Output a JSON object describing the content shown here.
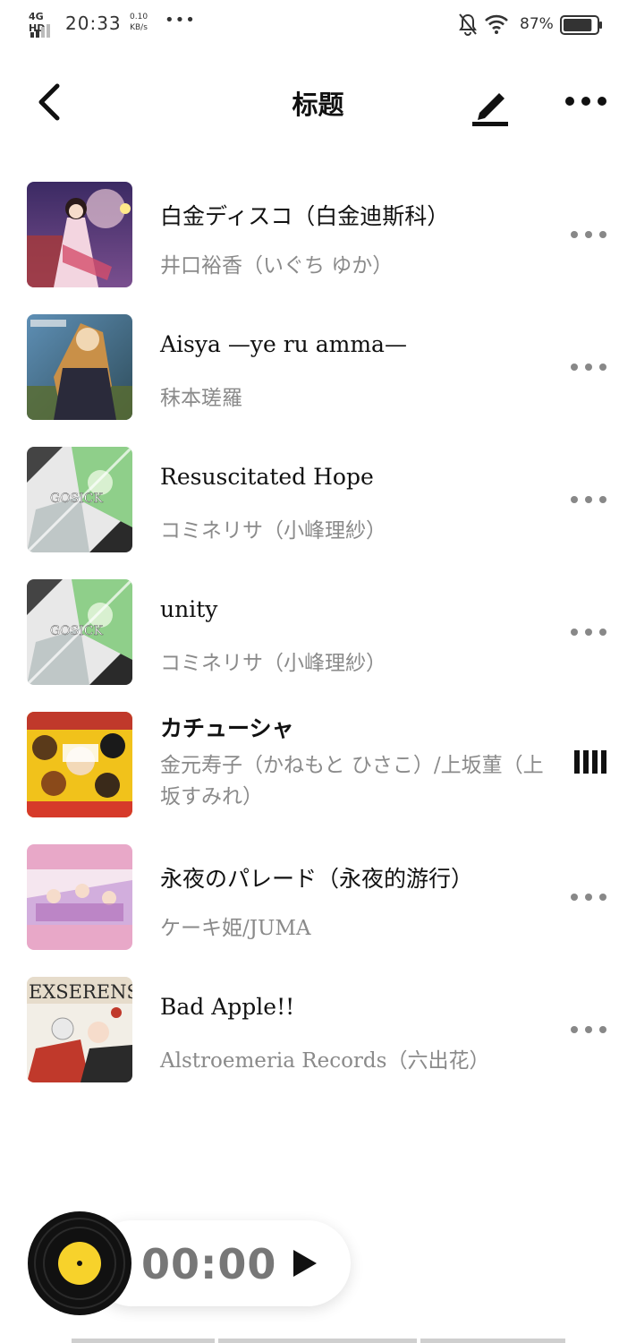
{
  "status_bar": {
    "network": "4G HD",
    "time": "20:33",
    "speed_value": "0.10",
    "speed_unit": "KB/s",
    "more": "•••",
    "battery_percent": "87%",
    "battery_level": 0.87
  },
  "header": {
    "title": "标题"
  },
  "songs": [
    {
      "title": "白金ディスコ（白金迪斯科）",
      "artist": "井口裕香（いぐち ゆか）",
      "cover": "cover-1",
      "playing": false
    },
    {
      "title": "Aisya —ye ru amma—",
      "artist": "秣本瑳羅",
      "cover": "cover-2",
      "playing": false
    },
    {
      "title": "Resuscitated Hope",
      "artist": "コミネリサ（小峰理紗）",
      "cover": "gosick",
      "playing": false
    },
    {
      "title": "unity",
      "artist": "コミネリサ（小峰理紗）",
      "cover": "gosick",
      "playing": false
    },
    {
      "title": "カチューシャ",
      "artist": "金元寿子（かねもと ひさこ）/上坂菫（上坂すみれ）",
      "cover": "cover-5",
      "playing": true
    },
    {
      "title": "永夜のパレード（永夜的游行）",
      "artist": "ケーキ姫/JUMA",
      "cover": "cover-6",
      "playing": false
    },
    {
      "title": "Bad Apple!!",
      "artist": "Alstroemeria Records（六出花）",
      "cover": "cover-7",
      "playing": false
    }
  ],
  "cover_text": {
    "gosick": "GOSICK",
    "exserens": "EXSERENS"
  },
  "player": {
    "time": "00:00"
  },
  "colors": {
    "accent_disc": "#f7d22b",
    "muted_text": "#8a8a8a"
  }
}
